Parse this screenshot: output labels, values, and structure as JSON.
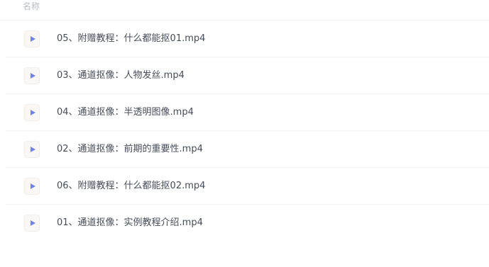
{
  "header": {
    "column_name_label": "名称"
  },
  "files": [
    {
      "name": "05、附赠教程：什么都能抠01.mp4",
      "icon": "video-file-icon"
    },
    {
      "name": "03、通道抠像：人物发丝.mp4",
      "icon": "video-file-icon"
    },
    {
      "name": "04、通道抠像：半透明图像.mp4",
      "icon": "video-file-icon"
    },
    {
      "name": "02、通道抠像：前期的重要性.mp4",
      "icon": "video-file-icon"
    },
    {
      "name": "06、附赠教程：什么都能抠02.mp4",
      "icon": "video-file-icon"
    },
    {
      "name": "01、通道抠像：实例教程介绍.mp4",
      "icon": "video-file-icon"
    }
  ],
  "colors": {
    "icon_play": "#6b86ee",
    "icon_background": "#fbf7f4",
    "text": "#454d5a",
    "header_text": "#b7bcc5",
    "divider": "#f1f2f4"
  }
}
